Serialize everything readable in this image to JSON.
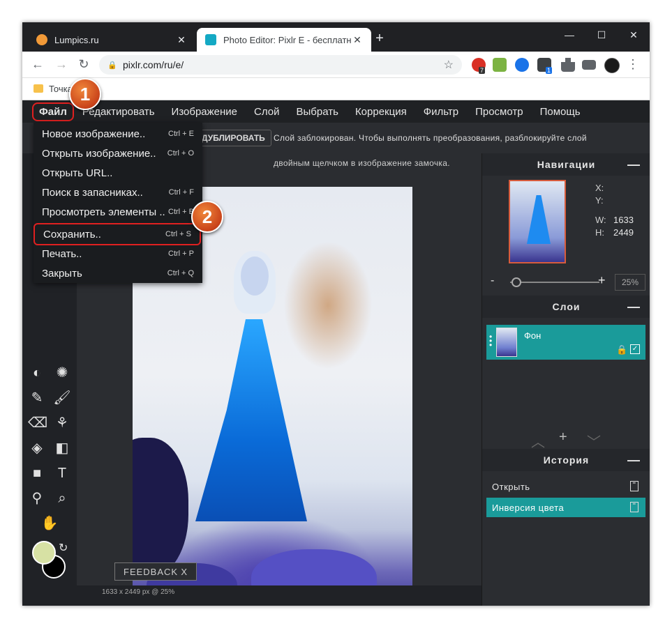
{
  "browser": {
    "tabs": [
      {
        "title": "Lumpics.ru",
        "active": false
      },
      {
        "title": "Photo Editor: Pixlr E - бесплатный",
        "active": true
      }
    ],
    "url": "pixlr.com/ru/e/",
    "bookmark": "Точка",
    "extension_badges": {
      "red": "7",
      "cube": "1"
    }
  },
  "menu": {
    "items": [
      "Файл",
      "Редактировать",
      "Изображение",
      "Слой",
      "Выбрать",
      "Коррекция",
      "Фильтр",
      "Просмотр",
      "Помощь"
    ]
  },
  "file_menu": [
    {
      "label": "Новое изображение..",
      "shortcut": "Ctrl + E"
    },
    {
      "label": "Открыть изображение..",
      "shortcut": "Ctrl + O"
    },
    {
      "label": "Открыть URL..",
      "shortcut": ""
    },
    {
      "label": "Поиск в запасниках..",
      "shortcut": "Ctrl + F"
    },
    {
      "label": "Просмотреть элементы ..",
      "shortcut": "Ctrl + B"
    },
    {
      "label": "Сохранить..",
      "shortcut": "Ctrl + S"
    },
    {
      "label": "Печать..",
      "shortcut": "Ctrl + P"
    },
    {
      "label": "Закрыть",
      "shortcut": "Ctrl + Q"
    }
  ],
  "options": {
    "duplicate_label": "ДУБЛИРОВАТЬ",
    "notice_line1": "Слой заблокирован. Чтобы выполнять преобразования, разблокируйте слой",
    "notice_line2": "двойным щелчком в изображение замочка."
  },
  "navigator": {
    "title": "Навигации",
    "x_label": "X:",
    "y_label": "Y:",
    "w_label": "W:",
    "h_label": "H:",
    "width": "1633",
    "height": "2449",
    "zoom": "25%"
  },
  "layers": {
    "title": "Слои",
    "items": [
      {
        "name": "Фон"
      }
    ]
  },
  "history": {
    "title": "История",
    "items": [
      {
        "label": "Открыть",
        "active": false
      },
      {
        "label": "Инверсия цвета",
        "active": true
      }
    ]
  },
  "canvas": {
    "status": "1633 x 2449 px @ 25%",
    "feedback": "FEEDBACK",
    "feedback_close": "X"
  },
  "colors": {
    "foreground": "#d7e1a4",
    "background": "#000000",
    "accent": "#1a9b9a",
    "callout": "#e02020"
  },
  "callouts": [
    "1",
    "2"
  ]
}
